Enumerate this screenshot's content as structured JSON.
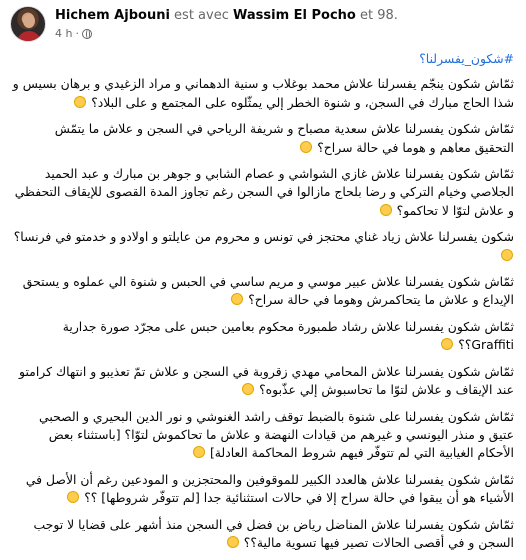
{
  "post": {
    "author": "Hichem Ajbouni",
    "with_text": "est avec",
    "tagged": "Wassim El Pocho",
    "and_more": "et 98.",
    "time": "4 h",
    "separator": "·"
  },
  "icons": {
    "privacy": "globe-icon",
    "reaction": "thinking-face-emoji"
  },
  "colors": {
    "hashtag": "#216fdb",
    "muted": "#65676b",
    "text": "#050505"
  },
  "content": {
    "hashtag": "#شكون_يفسرلنا؟",
    "paragraphs": [
      "ثمّاش شكون ينجّم يفسرلنا علاش محمد بوغلاب و سنية الدهماني و مراد الزغيدي و برهان بسيس و شذا الحاج مبارك في السجن، و شنوة الخطر إلي يمثّلوه على المجتمع و على البلاد؟",
      "ثمّاش شكون يفسرلنا علاش سعدية مصباح و شريفة الرياحي في السجن و علاش ما يتمّش التحقيق معاهم و هوما في حالة سراح؟",
      "ثمّاش شكون يفسرلنا علاش غازي الشواشي و عصام الشابي و جوهر بن مبارك و عبد الحميد الجلاصي وخيام التركي و رضا بلحاج مازالوا في السجن رغم تجاوز المدة القصوى للإيقاف التحفظي و علاش لتوّا لا تحاكمو؟",
      "شكون يفسرلنا علاش زياد غناي محتجز في تونس و محروم من عايلتو و اولادو و خدمتو في فرنسا؟",
      "ثمّاش شكون يفسرلنا علاش عبير موسي و مريم ساسي في الحبس و شنوة الي عملوه و يستحق الإيداع و علاش ما يتحاكمرش وهوما في حالة سراح؟",
      "ثمّاش شكون يفسرلنا علاش رشاد طمبورة محكوم بعامين حبس على مجرّد صورة جدارية Graffiti؟؟",
      "ثمّاش شكون يفسرلنا علاش المحامي مهدي زقروبة في السجن و علاش تمّ تعذيبو و انتهاك كرامتو عند الإيقاف و علاش لتوّا ما تحاسبوش إلي عذّبوه؟",
      "ثمّاش شكون يفسرلنا على شنوة بالضبط توقف راشد الغنوشي و نور الدين البحيري و الصحبي عتيق و منذر اليونسي و غيرهم من قيادات النهضة و علاش ما تحاكموش لتوّا؟ [باستثناء بعض الأحكام الغيابية التي لم تتوفّر فيهم شروط المحاكمة العادلة]",
      "ثمّاش شكون يفسرلنا علاش هالعدد الكبير للموقوفين والمحتجزين و المودعين رغم أن الأصل في الأشياء هو أن يبقوا في حالة سراح إلا في حالات استثنائية جدا [لم تتوفّر شروطها] ؟؟",
      "ثمّاش شكون يفسرلنا علاش المناضل رياض بن فضل في السجن منذ أشهر على قضايا لا توجب السجن و في أقصى الحالات تصير فيها تسوية مالية؟؟"
    ]
  }
}
